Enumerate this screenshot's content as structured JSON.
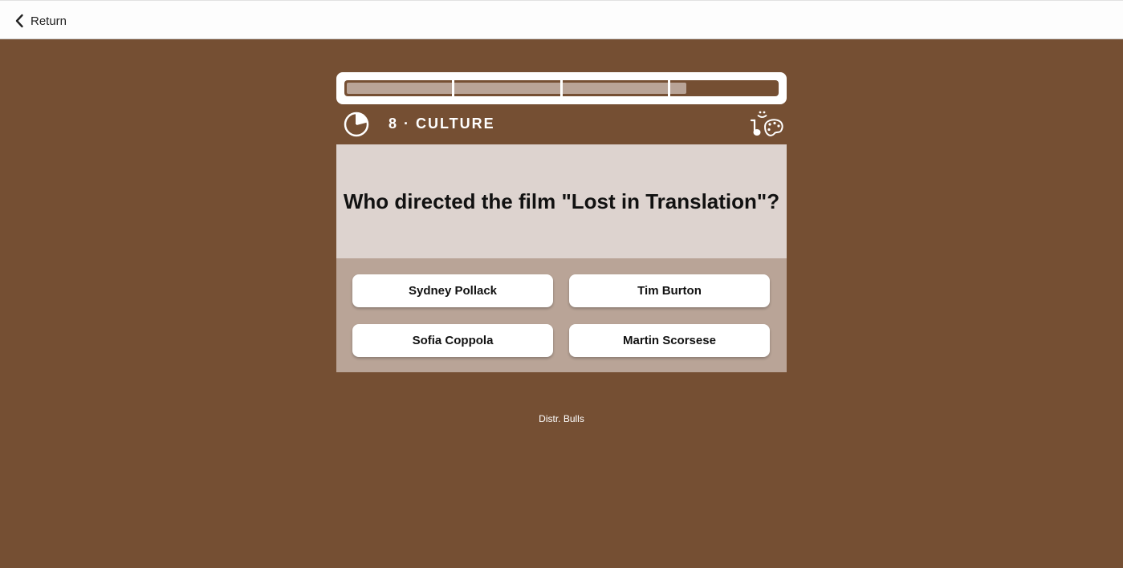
{
  "header": {
    "return_label": "Return"
  },
  "progress": {
    "fraction": 0.79,
    "segments": 4
  },
  "question": {
    "category": "8 · CULTURE",
    "category_icon": "pipe-palette-icon",
    "timer_icon": "timer-pie-icon",
    "text": "Who directed the film \"Lost in Translation\"?"
  },
  "answers": [
    {
      "label": "Sydney Pollack"
    },
    {
      "label": "Tim Burton"
    },
    {
      "label": "Sofia Coppola"
    },
    {
      "label": "Martin Scorsese"
    }
  ],
  "footer": {
    "credit": "Distr. Bulls"
  },
  "colors": {
    "background": "#754f33",
    "question_bg": "#ddd3cf",
    "answers_bg": "#b9a497",
    "progress_fill": "#b9a497"
  }
}
